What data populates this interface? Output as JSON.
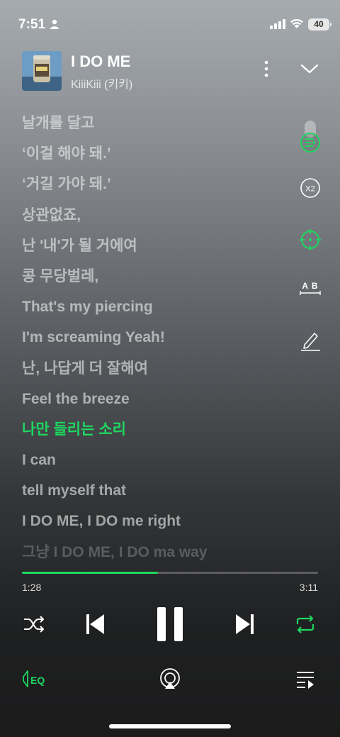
{
  "status_bar": {
    "time": "7:51",
    "battery": "40"
  },
  "track": {
    "title": "I DO ME",
    "artist": "KiiiKiii (키키)"
  },
  "lyrics": [
    "날개를 달고",
    "‘이걸 해야 돼.’",
    "‘거길 가야 돼.’",
    "상관없죠,",
    "난 '내'가 될 거에여",
    "콩 무당벌레,",
    "That's my piercing",
    "I'm screaming Yeah!",
    "난, 나답게 더 잘해여",
    "Feel the breeze",
    "나만 들리는 소리",
    "I can",
    "tell myself that",
    "I DO ME, I DO me right",
    "그냥 I DO ME, I DO ma way"
  ],
  "active_lyric_index": 10,
  "tools": {
    "speed_label": "X2",
    "translate_label": "A B"
  },
  "playback": {
    "elapsed": "1:28",
    "duration": "3:11",
    "progress": 0.46
  },
  "bottom_bar": {
    "eq_label": "EQ"
  },
  "colors": {
    "accent": "#1ed760",
    "text": "#ffffff",
    "muted": "#d8d8d8"
  },
  "icons": {
    "status": [
      "person-icon",
      "signal-icon",
      "wifi-icon",
      "battery-icon"
    ],
    "header": [
      "more-icon",
      "chevron-down-icon"
    ],
    "tools": [
      "lyrics-sync-icon",
      "speed-icon",
      "focus-icon",
      "translate-icon",
      "edit-lyrics-icon"
    ],
    "controls": [
      "shuffle-icon",
      "previous-icon",
      "pause-icon",
      "next-icon",
      "repeat-icon"
    ],
    "bottom": [
      "eq-icon",
      "airplay-icon",
      "queue-icon"
    ]
  }
}
